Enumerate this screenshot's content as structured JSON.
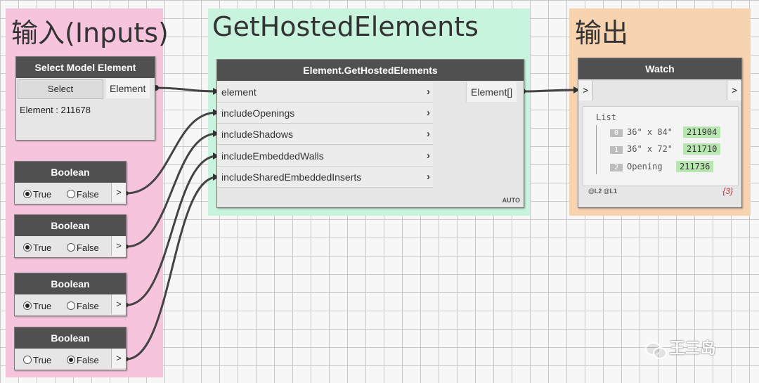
{
  "groups": {
    "inputs": {
      "title": "输入(Inputs)",
      "color": "#f7c4de"
    },
    "function": {
      "title": "GetHostedElements",
      "color": "#c8f3dd"
    },
    "output": {
      "title": "输出",
      "color": "#f8d3b0"
    }
  },
  "select_node": {
    "header": "Select Model Element",
    "button": "Select",
    "output_port": "Element",
    "readout": "Element : 211678"
  },
  "boolean_nodes": [
    {
      "header": "Boolean",
      "true_label": "True",
      "false_label": "False",
      "selected": "True",
      "out": ">"
    },
    {
      "header": "Boolean",
      "true_label": "True",
      "false_label": "False",
      "selected": "True",
      "out": ">"
    },
    {
      "header": "Boolean",
      "true_label": "True",
      "false_label": "False",
      "selected": "True",
      "out": ">"
    },
    {
      "header": "Boolean",
      "true_label": "True",
      "false_label": "False",
      "selected": "False",
      "out": ">"
    }
  ],
  "hosted_node": {
    "header": "Element.GetHostedElements",
    "inputs": [
      "element",
      "includeOpenings",
      "includeShadows",
      "includeEmbeddedWalls",
      "includeSharedEmbeddedInserts"
    ],
    "output_port": "Element[]",
    "lacing": "AUTO"
  },
  "watch_node": {
    "header": "Watch",
    "in_port": ">",
    "out_port": ">",
    "list_label": "List",
    "items": [
      {
        "index": "0",
        "name": "36\" x 84\"",
        "id": "211904"
      },
      {
        "index": "1",
        "name": "36\" x 72\"",
        "id": "211710"
      },
      {
        "index": "2",
        "name": "Opening",
        "id": "211736"
      }
    ],
    "levels": "@L2 @L1",
    "count": "{3}"
  },
  "watermark": "王三岛"
}
